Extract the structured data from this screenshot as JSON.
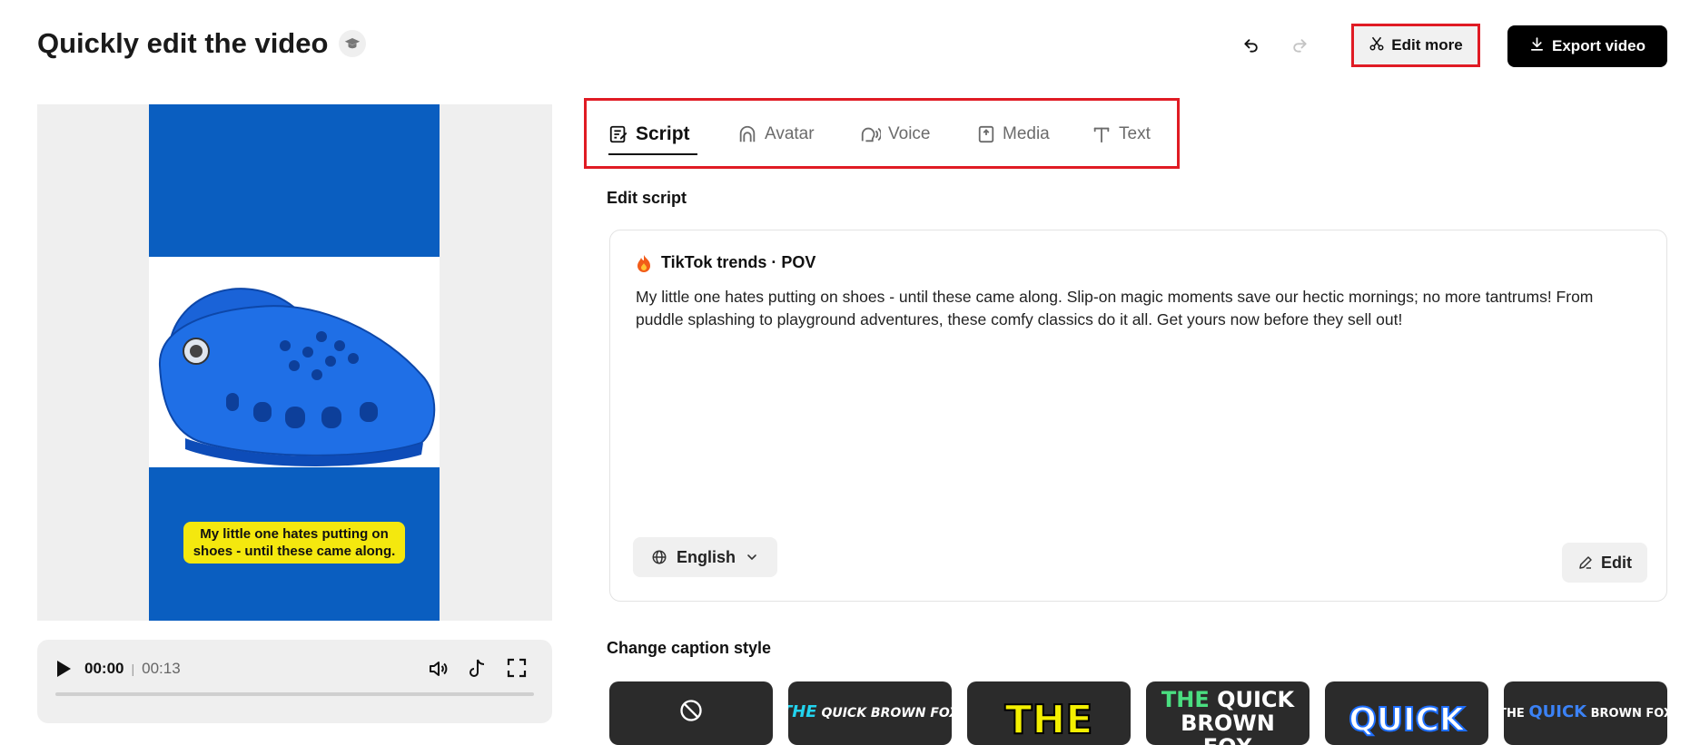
{
  "header": {
    "title": "Quickly edit the video",
    "edit_more_label": "Edit more",
    "export_label": "Export video"
  },
  "preview": {
    "caption_text": "My little one hates putting on shoes - until these came along.",
    "video_bg_color": "#0a5ec0",
    "caption_bg_color": "#f4e80e"
  },
  "player": {
    "current_time": "00:00",
    "separator": "|",
    "duration": "00:13",
    "progress": 0
  },
  "tabs": [
    {
      "label": "Script",
      "icon": "script-icon",
      "active": true
    },
    {
      "label": "Avatar",
      "icon": "avatar-icon",
      "active": false
    },
    {
      "label": "Voice",
      "icon": "voice-icon",
      "active": false
    },
    {
      "label": "Media",
      "icon": "media-icon",
      "active": false
    },
    {
      "label": "Text",
      "icon": "text-icon",
      "active": false
    }
  ],
  "script": {
    "section_label": "Edit script",
    "heading": "TikTok trends · POV",
    "body": "My little one hates putting on shoes - until these came along. Slip-on magic moments save our hectic mornings; no more tantrums! From puddle splashing to playground adventures, these comfy classics do it all. Get yours now before they sell out!",
    "language": "English",
    "edit_label": "Edit"
  },
  "caption_styles": {
    "section_label": "Change caption style",
    "styles": [
      {
        "name": "none",
        "text": ""
      },
      {
        "name": "style-1",
        "text": "THE QUICK BROWN FOX"
      },
      {
        "name": "style-2",
        "text": "THE"
      },
      {
        "name": "style-3",
        "text": "THE QUICK BROWN FOX"
      },
      {
        "name": "style-4",
        "text": "QUICK"
      },
      {
        "name": "style-5",
        "text": "THE QUICK BROWN FOX"
      }
    ]
  },
  "colors": {
    "highlight_border": "#e01b24",
    "export_bg": "#000000",
    "accent_blue": "#0a5ec0"
  }
}
